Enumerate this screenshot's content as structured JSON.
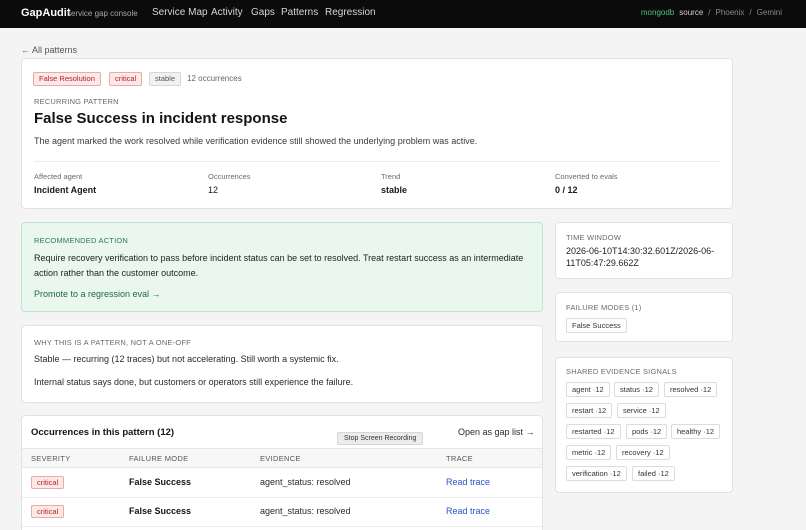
{
  "nav": {
    "brand": "GapAudit",
    "brand_sub": "service gap console",
    "links": [
      "Service Map",
      "Activity",
      "Gaps",
      "Patterns",
      "Regression"
    ],
    "breadcrumb": [
      "mongodb",
      "source",
      "/",
      "Phoenix",
      "/",
      "Gemini"
    ]
  },
  "back_link": "← All patterns",
  "pattern": {
    "tags": [
      "False Resolution",
      "critical",
      "stable"
    ],
    "occurrences_text": "12 occurrences",
    "eyebrow": "RECURRING PATTERN",
    "title": "False Success in incident response",
    "description": "The agent marked the work resolved while verification evidence still showed the underlying problem was active.",
    "stats": [
      {
        "label": "Affected agent",
        "value": "Incident Agent"
      },
      {
        "label": "Occurrences",
        "value": "12"
      },
      {
        "label": "Trend",
        "value": "stable"
      },
      {
        "label": "Converted to evals",
        "value": "0 / 12"
      }
    ]
  },
  "recommended": {
    "eyebrow": "RECOMMENDED ACTION",
    "text": "Require recovery verification to pass before incident status can be set to resolved. Treat restart success as an intermediate action rather than the customer outcome.",
    "link": "Promote to a regression eval →"
  },
  "why": {
    "eyebrow": "WHY THIS IS A PATTERN, NOT A ONE-OFF",
    "line1": "Stable — recurring (12 traces) but not accelerating. Still worth a systemic fix.",
    "line2": "Internal status says done, but customers or operators still experience the failure."
  },
  "occurrences": {
    "title": "Occurrences in this pattern (12)",
    "stop_recording": "Stop Screen Recording",
    "open_list": "Open as gap list →",
    "columns": [
      "SEVERITY",
      "FAILURE MODE",
      "EVIDENCE",
      "TRACE"
    ],
    "rows": [
      {
        "severity": "critical",
        "failure_mode": "False Success",
        "evidence": "agent_status: resolved",
        "trace": "Read trace"
      },
      {
        "severity": "critical",
        "failure_mode": "False Success",
        "evidence": "agent_status: resolved",
        "trace": "Read trace"
      }
    ]
  },
  "side": {
    "time_window_label": "TIME WINDOW",
    "time_window_value": "2026-06-10T14:30:32.601Z/2026-06-11T05:47:29.662Z",
    "failure_modes_label": "FAILURE MODES (1)",
    "failure_modes": [
      "False Success"
    ],
    "signals_label": "SHARED EVIDENCE SIGNALS",
    "signals": [
      "agent ·12",
      "status ·12",
      "resolved ·12",
      "restart ·12",
      "service ·12",
      "restarted ·12",
      "pods ·12",
      "healthy ·12",
      "metric ·12",
      "recovery ·12",
      "verification ·12",
      "failed ·12"
    ]
  }
}
